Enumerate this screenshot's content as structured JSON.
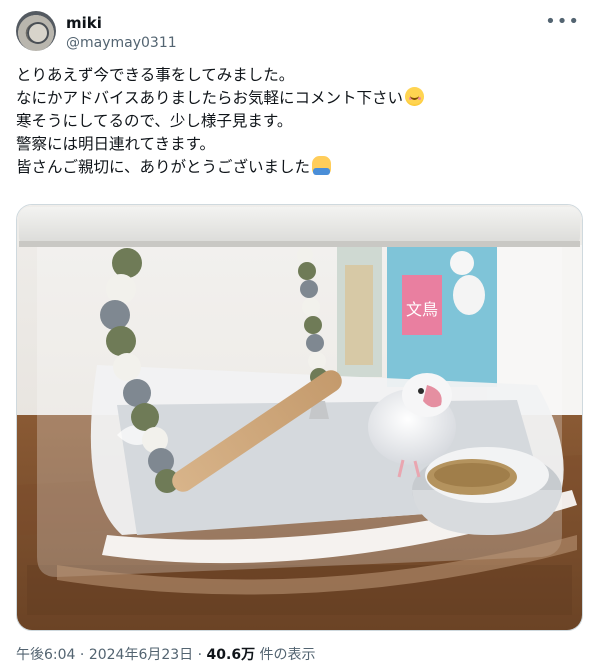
{
  "user": {
    "name": "miki",
    "handle": "@maymay0311"
  },
  "tweet": {
    "lines": [
      "とりあえず今できる事をしてみました。",
      "なにかアドバイスありましたらお気軽にコメント下さい",
      "寒そうにしてるので、少し様子見ます。",
      "警察には明日連れてきます。",
      "皆さんご親切に、ありがとうございました"
    ],
    "emojis": [
      "smiling-face-emoji",
      "bowing-person-emoji"
    ]
  },
  "media": {
    "bag_label": "文鳥"
  },
  "meta": {
    "time": "午後6:04",
    "sep1": " · ",
    "date": "2024年6月23日",
    "sep2": " · ",
    "views": "40.6万",
    "views_label": " 件の表示"
  },
  "icons": {
    "more": "more-options-icon"
  },
  "colors": {
    "text": "#0f1419",
    "secondary": "#536471",
    "border": "#cfd9de"
  }
}
